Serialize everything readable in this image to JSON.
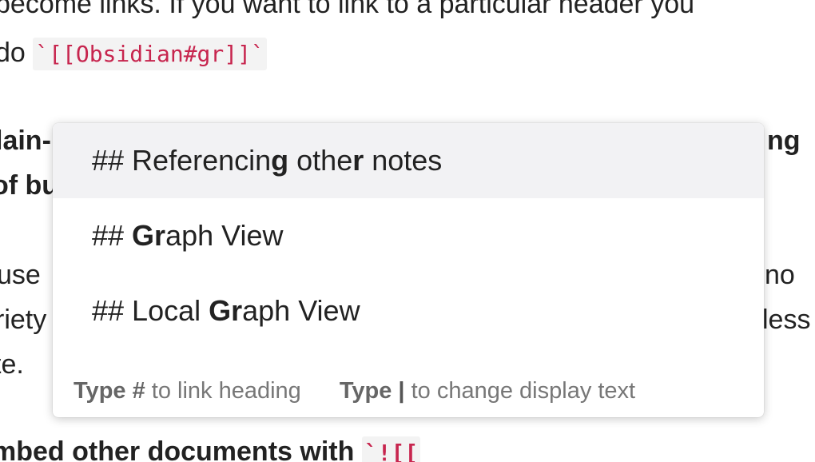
{
  "background_text": {
    "line1": "become links. If you want to link to a particular header you",
    "line2_prefix": "do ",
    "line2_code": "`[[Obsidian#gr]]`",
    "line3_left": "lain-",
    "line3_right": "ng",
    "line4_left": "of bu",
    "line5_left": "use",
    "line5_right": "no",
    "line6_left": "riety",
    "line6_right": "less",
    "line7_left": "te.",
    "line8_bold": "mbed other documents with ",
    "line8_code": "`![["
  },
  "popup": {
    "suggestions": [
      {
        "prefix": "## Referencin",
        "m1": "g",
        "mid": " othe",
        "m2": "r",
        "suffix": " notes",
        "selected": true
      },
      {
        "prefix": "## ",
        "match": "Gr",
        "suffix": "aph View",
        "selected": false
      },
      {
        "prefix": "## Local ",
        "match": "Gr",
        "suffix": "aph View",
        "selected": false
      }
    ],
    "footer": {
      "hint1_keyword": "Type #",
      "hint1_text": " to link heading",
      "hint2_keyword": "Type",
      "hint2_symbol": "|",
      "hint2_text": " to change display text"
    }
  },
  "colors": {
    "code_text": "#c7254e",
    "code_bg": "#f3f3f3",
    "selected_bg": "#f2f2f4",
    "hint_text": "#777777"
  }
}
